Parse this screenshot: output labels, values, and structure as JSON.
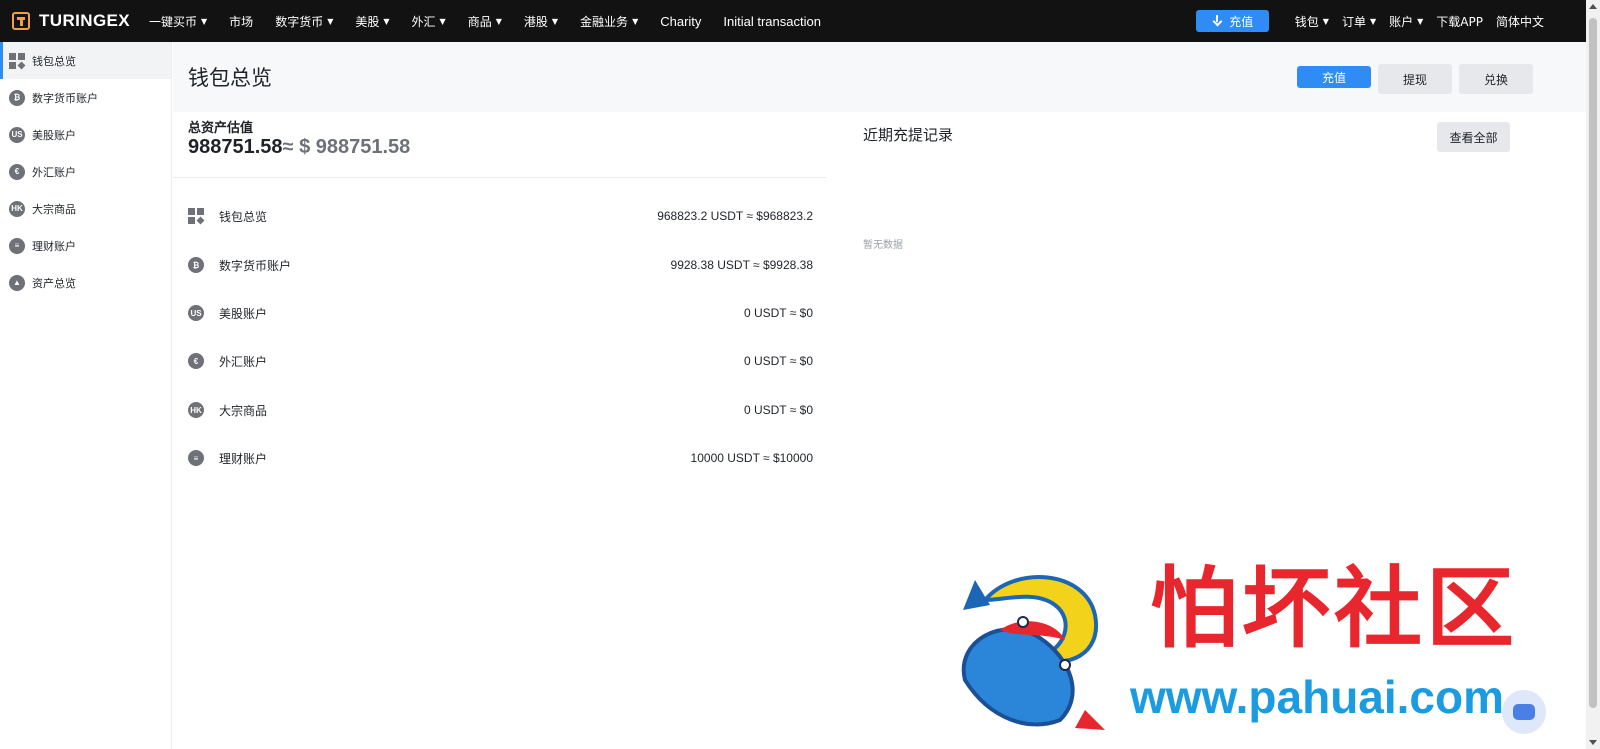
{
  "brand": {
    "name": "TURINGEX"
  },
  "nav": {
    "items": [
      {
        "label": "一键买币",
        "dropdown": true
      },
      {
        "label": "市场",
        "dropdown": false
      },
      {
        "label": "数字货币",
        "dropdown": true
      },
      {
        "label": "美股",
        "dropdown": true
      },
      {
        "label": "外汇",
        "dropdown": true
      },
      {
        "label": "商品",
        "dropdown": true
      },
      {
        "label": "港股",
        "dropdown": true
      },
      {
        "label": "金融业务",
        "dropdown": true
      },
      {
        "label": "Charity",
        "dropdown": false
      },
      {
        "label": "Initial transaction",
        "dropdown": false
      }
    ],
    "deposit": "充值",
    "wallet": "钱包",
    "orders": "订单",
    "account": "账户",
    "download": "下载APP",
    "language": "简体中文",
    "caret": "▼"
  },
  "sidebar": {
    "items": [
      {
        "label": "钱包总览",
        "icon": "grid-icon",
        "active": true
      },
      {
        "label": "数字货币账户",
        "icon": "bitcoin-icon",
        "badge": "₿"
      },
      {
        "label": "美股账户",
        "icon": "us-icon",
        "badge": "US"
      },
      {
        "label": "外汇账户",
        "icon": "forex-icon",
        "badge": "€"
      },
      {
        "label": "大宗商品",
        "icon": "hk-icon",
        "badge": "HK"
      },
      {
        "label": "理财账户",
        "icon": "finance-icon",
        "badge": "≡"
      },
      {
        "label": "资产总览",
        "icon": "mountain-icon",
        "badge": "▲"
      }
    ]
  },
  "page": {
    "title": "钱包总览",
    "buttons": {
      "deposit": "充值",
      "withdraw": "提现",
      "exchange": "兑换"
    }
  },
  "assets": {
    "total_label": "总资产估值",
    "total_usdt": "988751.58",
    "approx": "≈ $ 988751.58",
    "rows": [
      {
        "name": "钱包总览",
        "value": "968823.2 USDT ≈ $968823.2",
        "icon": "grid-icon"
      },
      {
        "name": "数字货币账户",
        "value": "9928.38 USDT ≈ $9928.38",
        "icon": "bitcoin-icon",
        "badge": "₿"
      },
      {
        "name": "美股账户",
        "value": "0 USDT ≈ $0",
        "icon": "us-icon",
        "badge": "US"
      },
      {
        "name": "外汇账户",
        "value": "0 USDT ≈ $0",
        "icon": "forex-icon",
        "badge": "€"
      },
      {
        "name": "大宗商品",
        "value": "0 USDT ≈ $0",
        "icon": "hk-icon",
        "badge": "HK"
      },
      {
        "name": "理财账户",
        "value": "10000 USDT ≈ $10000",
        "icon": "finance-icon",
        "badge": "≡"
      }
    ]
  },
  "records": {
    "title": "近期充提记录",
    "view_all": "查看全部",
    "empty": "暂无数据"
  },
  "watermark": {
    "title": "怕坏社区",
    "url": "www.pahuai.com"
  },
  "colors": {
    "accent": "#2f8cf4",
    "nav_bg": "#121212",
    "brand_orange": "#f0a23a",
    "watermark_red": "#e8262d",
    "watermark_blue": "#1b9be0"
  }
}
